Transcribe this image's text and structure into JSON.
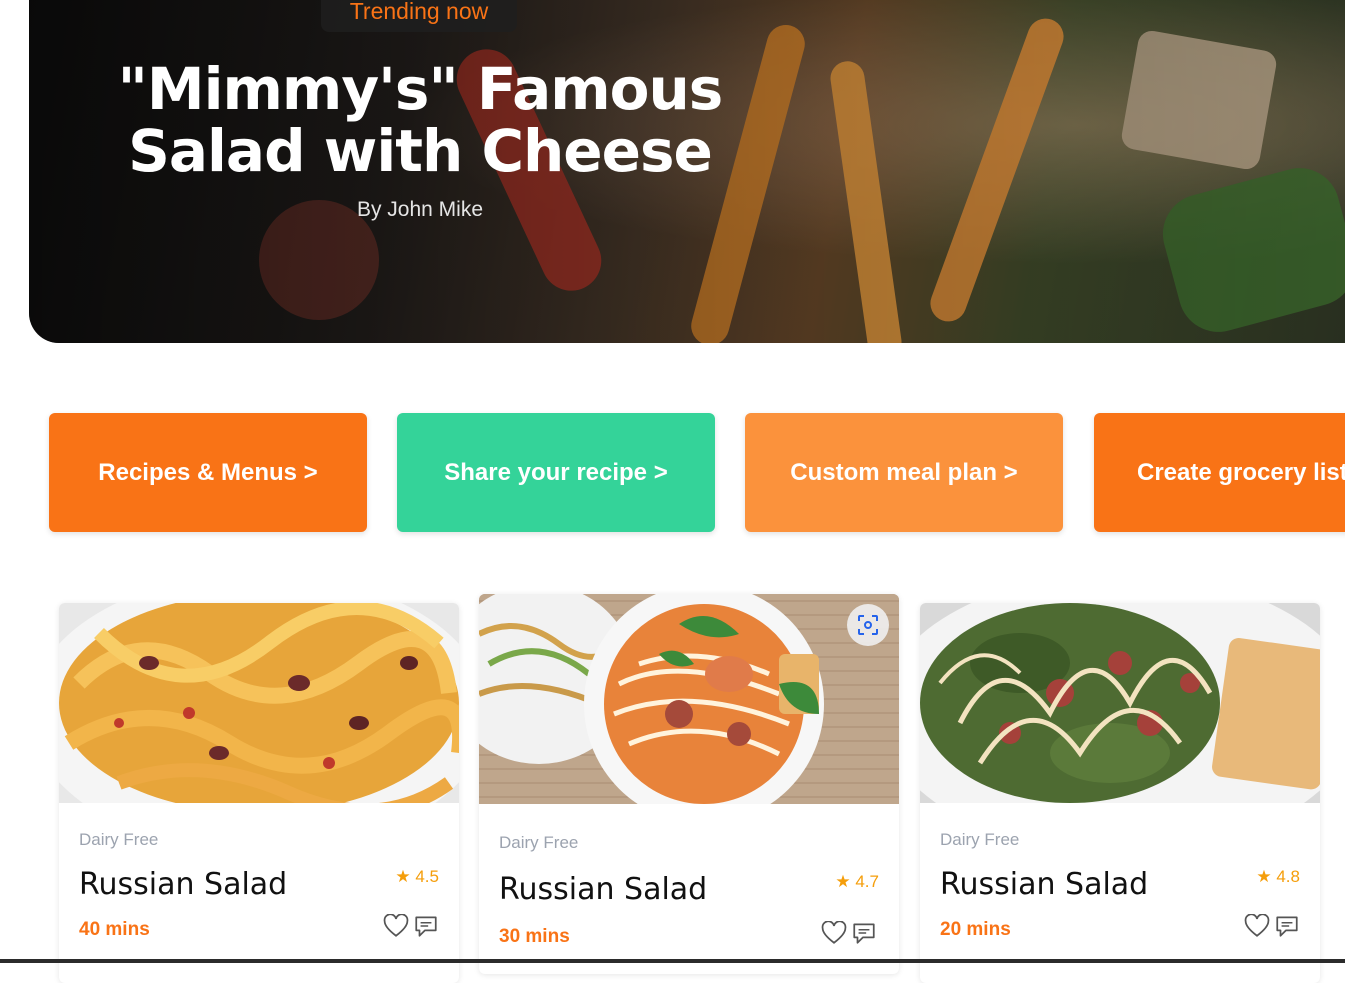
{
  "hero": {
    "badge": "Trending now",
    "title": "\"Mimmy's\" Famous Salad with Cheese",
    "author": "By John Mike"
  },
  "actions": [
    {
      "label": "Recipes & Menus >",
      "color": "#f97316"
    },
    {
      "label": "Share your recipe >",
      "color": "#34d399"
    },
    {
      "label": "Custom meal plan >",
      "color": "#fb923c"
    },
    {
      "label": "Create grocery list >",
      "color": "#f97316"
    }
  ],
  "recipes": [
    {
      "tag": "Dairy Free",
      "name": "Russian Salad",
      "rating": "★ 4.5",
      "time": "40 mins",
      "image": "pasta-dish"
    },
    {
      "tag": "Dairy Free",
      "name": "Russian Salad",
      "rating": "★ 4.7",
      "time": "30 mins",
      "image": "noodle-soup"
    },
    {
      "tag": "Dairy Free",
      "name": "Russian Salad",
      "rating": "★ 4.8",
      "time": "20 mins",
      "image": "caesar-salad"
    }
  ],
  "icons": {
    "like": "heart-icon",
    "comment": "comment-icon",
    "visual_search": "lens-icon"
  },
  "colors": {
    "accent": "#f97316",
    "green": "#34d399",
    "light_orange": "#fb923c",
    "rating": "#f59e0b"
  }
}
